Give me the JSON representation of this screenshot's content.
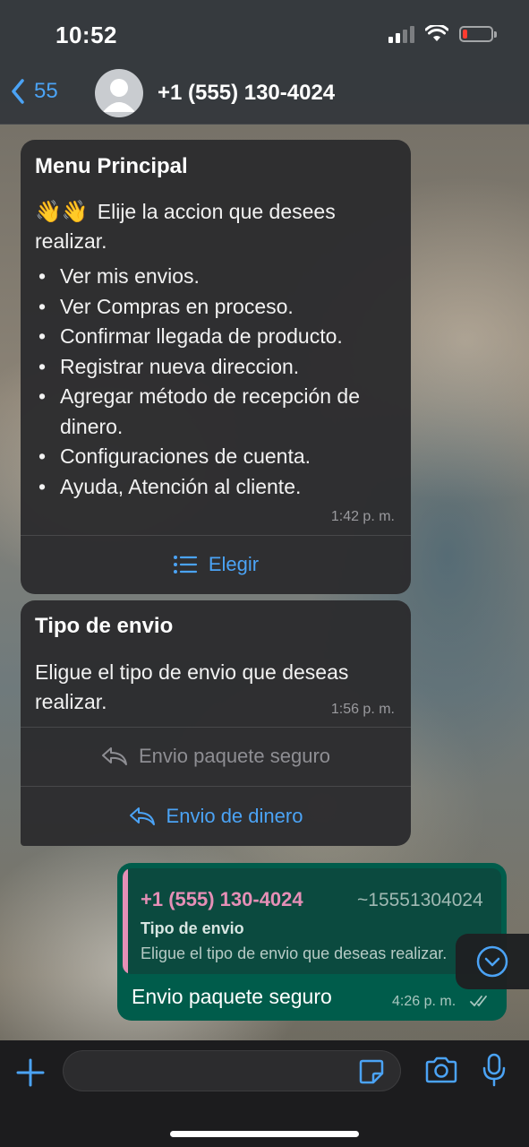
{
  "status_bar": {
    "time": "10:52"
  },
  "header": {
    "back_count": "55",
    "contact_name": "+1 (555) 130-4024"
  },
  "messages": [
    {
      "title": "Menu Principal",
      "emoji": "👋👋",
      "body": "Elije la accion que desees realizar.",
      "items": [
        "Ver mis envios.",
        "Ver Compras en proceso.",
        "Confirmar llegada de producto.",
        "Registrar nueva direccion.",
        "Agregar método de recepción de dinero.",
        "Configuraciones de cuenta.",
        "Ayuda, Atención al cliente."
      ],
      "time": "1:42 p. m.",
      "button": "Elegir"
    },
    {
      "title": "Tipo de envio",
      "body": "Eligue el tipo de envio que deseas realizar.",
      "time": "1:56 p. m.",
      "buttons": [
        "Envio paquete seguro",
        "Envio de dinero"
      ]
    }
  ],
  "reply": {
    "quoted_name": "+1 (555) 130-4024",
    "quoted_number": "~15551304024",
    "quoted_title": "Tipo de envio",
    "quoted_text": "Eligue el tipo de envio que deseas realizar.",
    "text": "Envio paquete seguro",
    "time": "4:26 p. m."
  },
  "composer": {
    "placeholder": ""
  },
  "colors": {
    "accent": "#4ba3f5",
    "sent_bubble": "#005c4b",
    "quote_name": "#e58fb6"
  },
  "icons": [
    "back-chevron-icon",
    "avatar-icon",
    "list-icon",
    "reply-icon",
    "scroll-down-icon",
    "plus-icon",
    "sticker-icon",
    "camera-icon",
    "mic-icon",
    "double-check-icon"
  ]
}
